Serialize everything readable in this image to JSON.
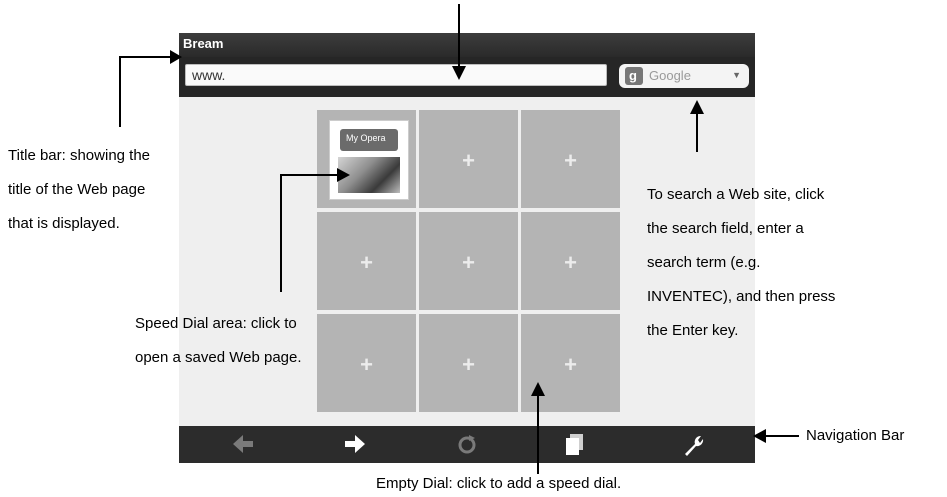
{
  "browser": {
    "title": "Bream",
    "address_value": "www.",
    "search": {
      "engine_label": "Google",
      "logo_icon": "google-icon",
      "dropdown_icon": "caret-down-icon"
    },
    "speed_dial": {
      "tiles": [
        {
          "label": "My Opera",
          "type": "saved"
        },
        {
          "label": "+",
          "type": "empty"
        },
        {
          "label": "+",
          "type": "empty"
        },
        {
          "label": "+",
          "type": "empty"
        },
        {
          "label": "+",
          "type": "empty"
        },
        {
          "label": "+",
          "type": "empty"
        },
        {
          "label": "+",
          "type": "empty"
        },
        {
          "label": "+",
          "type": "empty"
        },
        {
          "label": "+",
          "type": "empty"
        }
      ]
    },
    "navigation_bar": [
      {
        "name": "back",
        "icon": "arrow-left-icon",
        "enabled": false
      },
      {
        "name": "forward",
        "icon": "arrow-right-icon",
        "enabled": true
      },
      {
        "name": "reload",
        "icon": "reload-icon",
        "enabled": false
      },
      {
        "name": "tabs",
        "icon": "windows-icon",
        "enabled": true
      },
      {
        "name": "settings",
        "icon": "wrench-icon",
        "enabled": true
      }
    ]
  },
  "annotations": {
    "title_bar": [
      "Title bar: showing the",
      "title of the Web page",
      "that is displayed."
    ],
    "search": [
      "To search a Web site, click",
      "the search field, enter a",
      "search term (e.g.",
      "INVENTEC), and then press",
      "the Enter key."
    ],
    "speed_dial": [
      "Speed Dial area: click to",
      "open a saved Web page."
    ],
    "empty_dial": "Empty Dial: click to add a speed dial.",
    "navigation_bar": "Navigation Bar"
  },
  "colors": {
    "titlebar": "#333333",
    "dial_tile": "#b4b4b4",
    "navbar": "#2c2c2c",
    "active_icon": "#ffffff",
    "disabled_icon": "#7a7a7a"
  }
}
